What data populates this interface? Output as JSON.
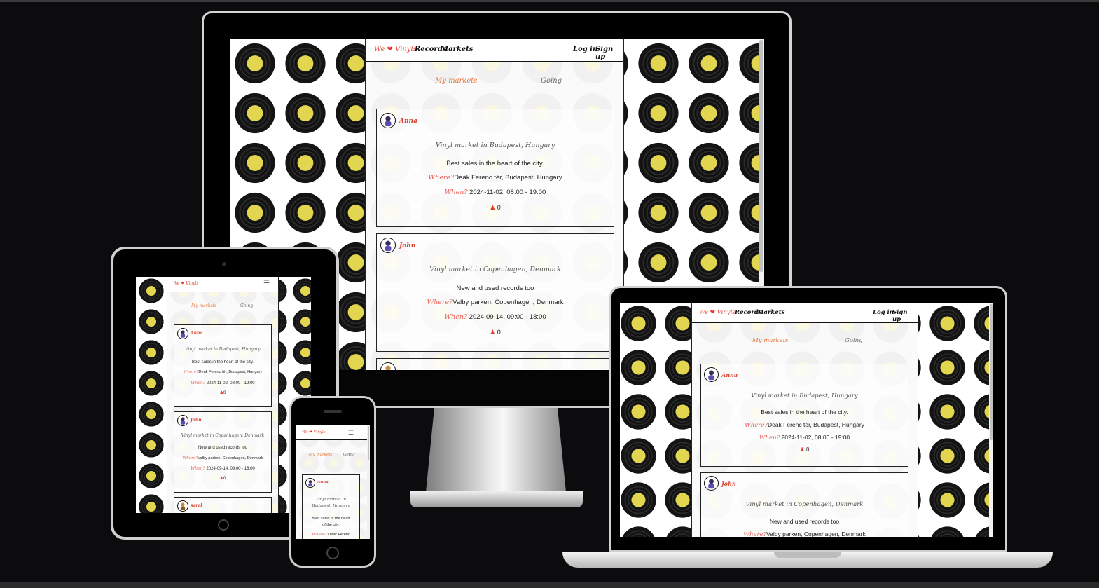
{
  "nav": {
    "brand_we": "We",
    "brand_heart": "❤",
    "brand_vinyls": "Vinyls",
    "records": "Records",
    "markets": "Markets",
    "login": "Log in",
    "signup": "Sign up",
    "menu_icon": "hamburger-icon"
  },
  "tabs": {
    "my_markets": "My markets",
    "going": "Going"
  },
  "markets": [
    {
      "user": "Anna",
      "title": "Vinyl market in Budapest, Hungary",
      "description": "Best sales in the heart of the city.",
      "where_label": "Where?",
      "where": "Deák Ferenc tér, Budapest, Hungary",
      "when_label": "When?",
      "when": "2024-11-02, 08:00 - 19:00",
      "attendees": "0"
    },
    {
      "user": "John",
      "title": "Vinyl market in Copenhagen, Denmark",
      "description": "New and used records too",
      "where_label": "Where?",
      "where": "Valby parken, Copenhagen, Denmark",
      "when_label": "When?",
      "when": "2024-09-14, 09:00 - 18:00",
      "attendees": "0"
    },
    {
      "user": "sarel"
    }
  ],
  "phone_view": {
    "title_line1": "Vinyl market in",
    "title_line2": "Budapest, Hungary",
    "desc_line1": "Best sales in the heart",
    "desc_line2": "of the city.",
    "where_partial": "Deák Ferenc"
  },
  "colors": {
    "accent": "#e34b3c",
    "tab_active": "#e8753c",
    "background": "#0c0b0d",
    "vinyl_label": "#e2d54f"
  }
}
